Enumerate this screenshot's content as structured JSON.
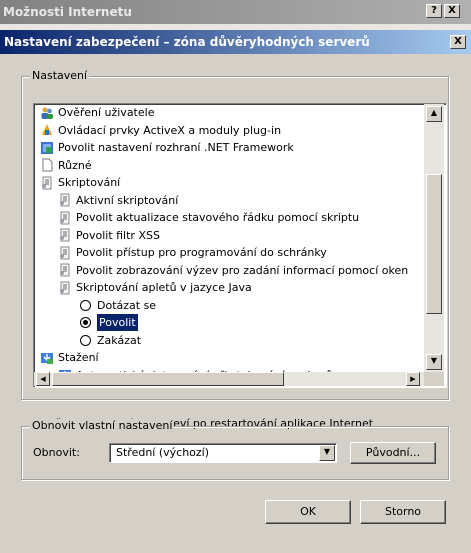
{
  "background_window": {
    "title": "Možnosti Internetu",
    "help_btn": "?",
    "close_btn": "X"
  },
  "dialog": {
    "title": "Nastavení zabezpečení – zóna důvěryhodných serverů",
    "close_btn": "X"
  },
  "settings_group": {
    "label": "Nastavení",
    "items": [
      {
        "label": "Ověření uživatele",
        "kind": "folder",
        "icon": "users-icon"
      },
      {
        "label": "Ovládací prvky ActiveX a moduly plug-in",
        "kind": "folder",
        "icon": "activex-icon"
      },
      {
        "label": "Povolit nastavení rozhraní .NET Framework",
        "kind": "folder",
        "icon": "dotnet-icon"
      },
      {
        "label": "Různé",
        "kind": "folder",
        "icon": "page-icon"
      },
      {
        "label": "Skriptování",
        "kind": "folder",
        "icon": "script-icon"
      },
      {
        "label": "Aktivní skriptování",
        "kind": "subfolder",
        "icon": "script-icon"
      },
      {
        "label": "Povolit aktualizace stavového řádku pomocí skriptu",
        "kind": "subfolder",
        "icon": "script-icon"
      },
      {
        "label": "Povolit filtr XSS",
        "kind": "subfolder",
        "icon": "script-icon"
      },
      {
        "label": "Povolit přístup pro programování do schránky",
        "kind": "subfolder",
        "icon": "script-icon"
      },
      {
        "label": "Povolit zobrazování výzev pro zadání informací pomocí oken",
        "kind": "subfolder",
        "icon": "script-icon"
      },
      {
        "label": "Skriptování apletů v jazyce Java",
        "kind": "subfolder",
        "icon": "script-icon"
      },
      {
        "label": "Dotázat se",
        "kind": "radio",
        "selected": false
      },
      {
        "label": "Povolit",
        "kind": "radio",
        "selected": true
      },
      {
        "label": "Zakázat",
        "kind": "radio",
        "selected": false
      },
      {
        "label": "Stažení",
        "kind": "folder",
        "icon": "download-icon"
      },
      {
        "label": "Automatické dotazování při stahování souborů",
        "kind": "subfolder",
        "icon": "download-icon"
      }
    ]
  },
  "restart_note": "*Změna nastavení se projeví po restartování aplikace Internet",
  "reset_group": {
    "label": "Obnovit vlastní nastavení",
    "reset_label": "Obnovit:",
    "combo_value": "Střední (výchozí)",
    "reset_button": "Původní..."
  },
  "buttons": {
    "ok": "OK",
    "cancel": "Storno"
  },
  "colors": {
    "title_active": "#0a246a",
    "selection": "#0a246a",
    "face": "#d4d0c8"
  }
}
